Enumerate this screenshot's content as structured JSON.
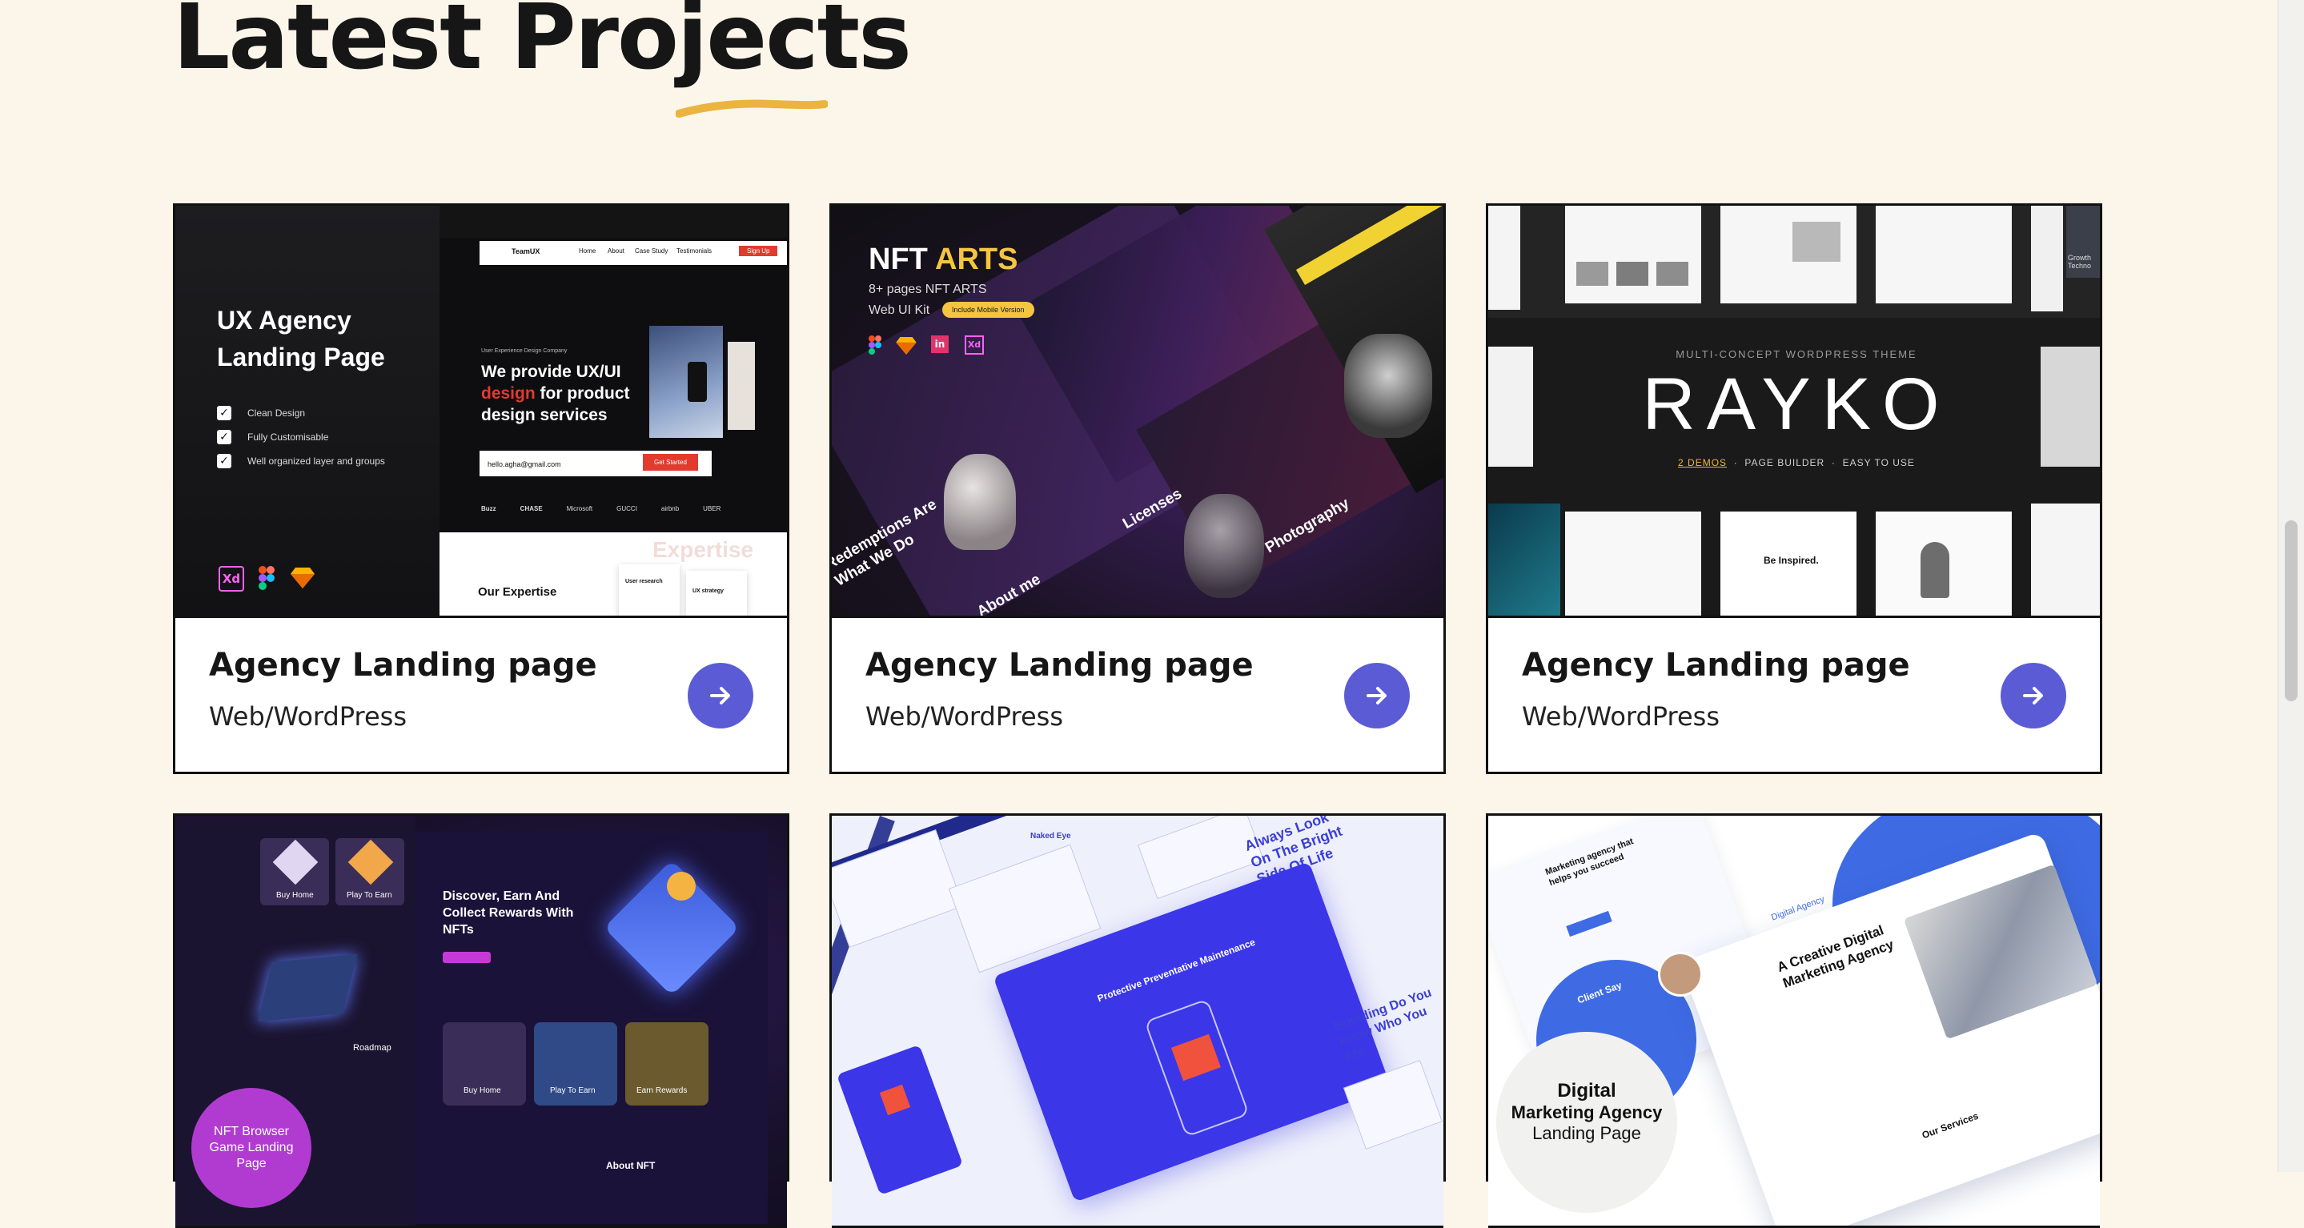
{
  "section": {
    "title": "Latest Projects",
    "accent_color": "#ebb43f"
  },
  "theme": {
    "background": "#fcf6ea",
    "arrow_color": "#5b5bd6",
    "card_border": "#111111"
  },
  "cards": [
    {
      "title": "Agency Landing page",
      "subtitle": "Web/WordPress",
      "image": {
        "headline": "UX Agency Landing Page",
        "features": [
          "Clean Design",
          "Fully Customisable",
          "Well organized layer and groups"
        ],
        "brand": "TeamUX",
        "nav": [
          "Home",
          "About",
          "Case Study",
          "Testimonials"
        ],
        "nav_button": "Sign Up",
        "eyebrow": "User Experience Design Company",
        "hero_line1": "We provide UX/UI",
        "hero_accent": "design",
        "hero_line2": "for product",
        "hero_line3": "design services",
        "email_placeholder": "hello.agha@gmail.com",
        "email_button": "Get Started",
        "logos": [
          "Buzz",
          "CHASE",
          "Microsoft",
          "GUCCI",
          "airbnb",
          "UBER"
        ],
        "section_heading": "Our Expertise",
        "section_bg_word": "Expertise",
        "mini_cards": [
          "User research",
          "UX strategy"
        ]
      }
    },
    {
      "title": "Agency Landing page",
      "subtitle": "Web/WordPress",
      "image": {
        "headline_a": "NFT",
        "headline_b": "ARTS",
        "line1": "8+ pages NFT ARTS",
        "line2": "Web UI Kit",
        "badge": "Include Mobile Version",
        "tilted": [
          "Redemptions Are What We Do",
          "About me",
          "Licenses",
          "Photography"
        ]
      }
    },
    {
      "title": "Agency Landing page",
      "subtitle": "Web/WordPress",
      "image": {
        "kicker": "MULTI-CONCEPT WORDPRESS THEME",
        "logo": "RAYKO",
        "tag_a": "2 DEMOS",
        "tag_b": "PAGE BUILDER",
        "tag_c": "EASY TO USE",
        "corner_text": "Growth Techno",
        "mockup_text": "Be Inspired."
      }
    },
    {
      "title": "",
      "subtitle": "",
      "image": {
        "tiles": [
          "Buy Home",
          "Play To Earn",
          "Earn Rewards"
        ],
        "hero": "Discover, Earn And Collect Rewards With NFTs",
        "roadmap": "Roadmap",
        "about": "About NFT",
        "badge": "NFT Browser Game Landing Page"
      }
    },
    {
      "title": "",
      "subtitle": "",
      "image": {
        "banner": "Protective Preventative Maintenance",
        "slogan_a": "Always Look On The Bright Side Of Life",
        "slogan_b": "Branding Do You Know Who You Are",
        "label": "Naked Eye"
      }
    },
    {
      "title": "",
      "subtitle": "",
      "image": {
        "headline": "A Creative Digital Marketing Agency",
        "tag": "Digital Agency",
        "left_note": "Marketing agency that helps you succeed",
        "client": "Client Say",
        "services": "Our Services",
        "badge_a": "Digital",
        "badge_b": "Marketing Agency",
        "badge_c": "Landing Page"
      }
    }
  ]
}
